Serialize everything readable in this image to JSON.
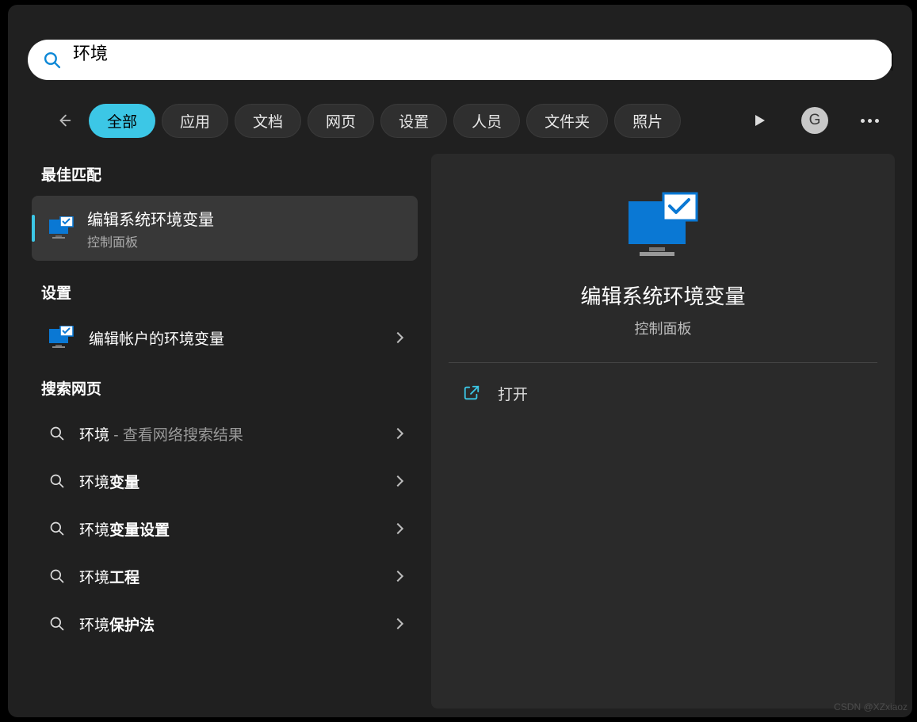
{
  "search": {
    "value": "环境"
  },
  "tabs": {
    "active": "全部",
    "list": [
      "全部",
      "应用",
      "文档",
      "网页",
      "设置",
      "人员",
      "文件夹",
      "照片"
    ]
  },
  "avatar": {
    "initial": "G"
  },
  "sections": {
    "best_match": "最佳匹配",
    "settings": "设置",
    "web": "搜索网页"
  },
  "best_match": {
    "title": "编辑系统环境变量",
    "subtitle": "控制面板"
  },
  "settings_items": [
    {
      "label": "编辑帐户的环境变量"
    }
  ],
  "web_items": [
    {
      "prefix": "环境",
      "suffix": " - 查看网络搜索结果",
      "suffix_style": "dim"
    },
    {
      "prefix": "环境",
      "suffix": "变量",
      "suffix_style": "bold"
    },
    {
      "prefix": "环境",
      "suffix": "变量设置",
      "suffix_style": "bold"
    },
    {
      "prefix": "环境",
      "suffix": "工程",
      "suffix_style": "bold"
    },
    {
      "prefix": "环境",
      "suffix": "保护法",
      "suffix_style": "bold"
    }
  ],
  "preview": {
    "title": "编辑系统环境变量",
    "subtitle": "控制面板",
    "open_label": "打开"
  },
  "watermark": "CSDN @XZxiaoz"
}
